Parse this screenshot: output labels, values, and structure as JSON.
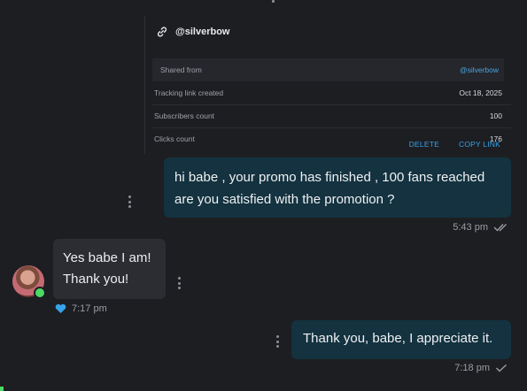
{
  "card": {
    "handle": "@silverbow",
    "rows": [
      {
        "label": "Shared from",
        "value": "@silverbow"
      },
      {
        "label": "Tracking link created",
        "value": "Oct 18, 2025"
      },
      {
        "label": "Subscribers count",
        "value": "100"
      },
      {
        "label": "Clicks count",
        "value": "176"
      }
    ],
    "actions": {
      "delete": "DELETE",
      "copy": "COPY LINK"
    },
    "icon": "link-icon"
  },
  "messages": [
    {
      "direction": "out",
      "lines": [
        "hi babe , your promo has finished , 100 fans reached",
        "are you satisfied with the promotion ?"
      ],
      "time": "5:43 pm",
      "status_icon": "double-check-icon"
    },
    {
      "direction": "in",
      "lines": [
        "Yes babe I am!",
        "Thank you!"
      ],
      "time": "7:17 pm",
      "reaction_icon": "heart-icon"
    },
    {
      "direction": "out",
      "lines": [
        "Thank you, babe, I appreciate it."
      ],
      "time": "7:18 pm",
      "status_icon": "check-icon"
    }
  ],
  "colors": {
    "accent": "#36a2ea",
    "outgoing_bubble": "#14323f",
    "incoming_bubble": "#2b2d32",
    "online": "#4cd964"
  }
}
